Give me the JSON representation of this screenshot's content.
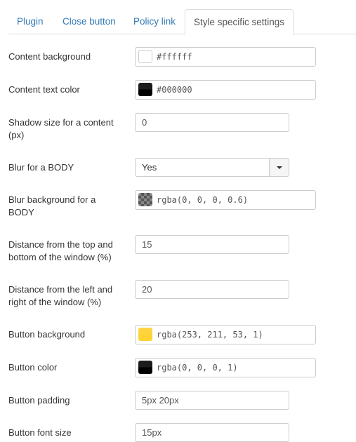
{
  "tabs": [
    {
      "label": "Plugin",
      "active": false
    },
    {
      "label": "Close button",
      "active": false
    },
    {
      "label": "Policy link",
      "active": false
    },
    {
      "label": "Style specific settings",
      "active": true
    }
  ],
  "fields": {
    "content_background": {
      "label": "Content background",
      "value": "#ffffff",
      "swatch": "#ffffff"
    },
    "content_text_color": {
      "label": "Content text color",
      "value": "#000000",
      "swatch": "#000000"
    },
    "shadow_size": {
      "label": "Shadow size for a content (px)",
      "value": "0"
    },
    "blur_body": {
      "label": "Blur for a BODY",
      "value": "Yes"
    },
    "blur_background": {
      "label": "Blur background for a BODY",
      "value": "rgba(0, 0, 0, 0.6)",
      "swatch": "rgba(0, 0, 0, 0.6)"
    },
    "distance_top_bottom": {
      "label": "Distance from the top and bottom of the window (%)",
      "value": "15"
    },
    "distance_left_right": {
      "label": "Distance from the left and right of the window (%)",
      "value": "20"
    },
    "button_background": {
      "label": "Button background",
      "value": "rgba(253, 211, 53, 1)",
      "swatch": "#fdd335"
    },
    "button_color": {
      "label": "Button color",
      "value": "rgba(0, 0, 0, 1)",
      "swatch": "#000000"
    },
    "button_padding": {
      "label": "Button padding",
      "value": "5px 20px"
    },
    "button_font_size": {
      "label": "Button font size",
      "value": "15px"
    }
  }
}
